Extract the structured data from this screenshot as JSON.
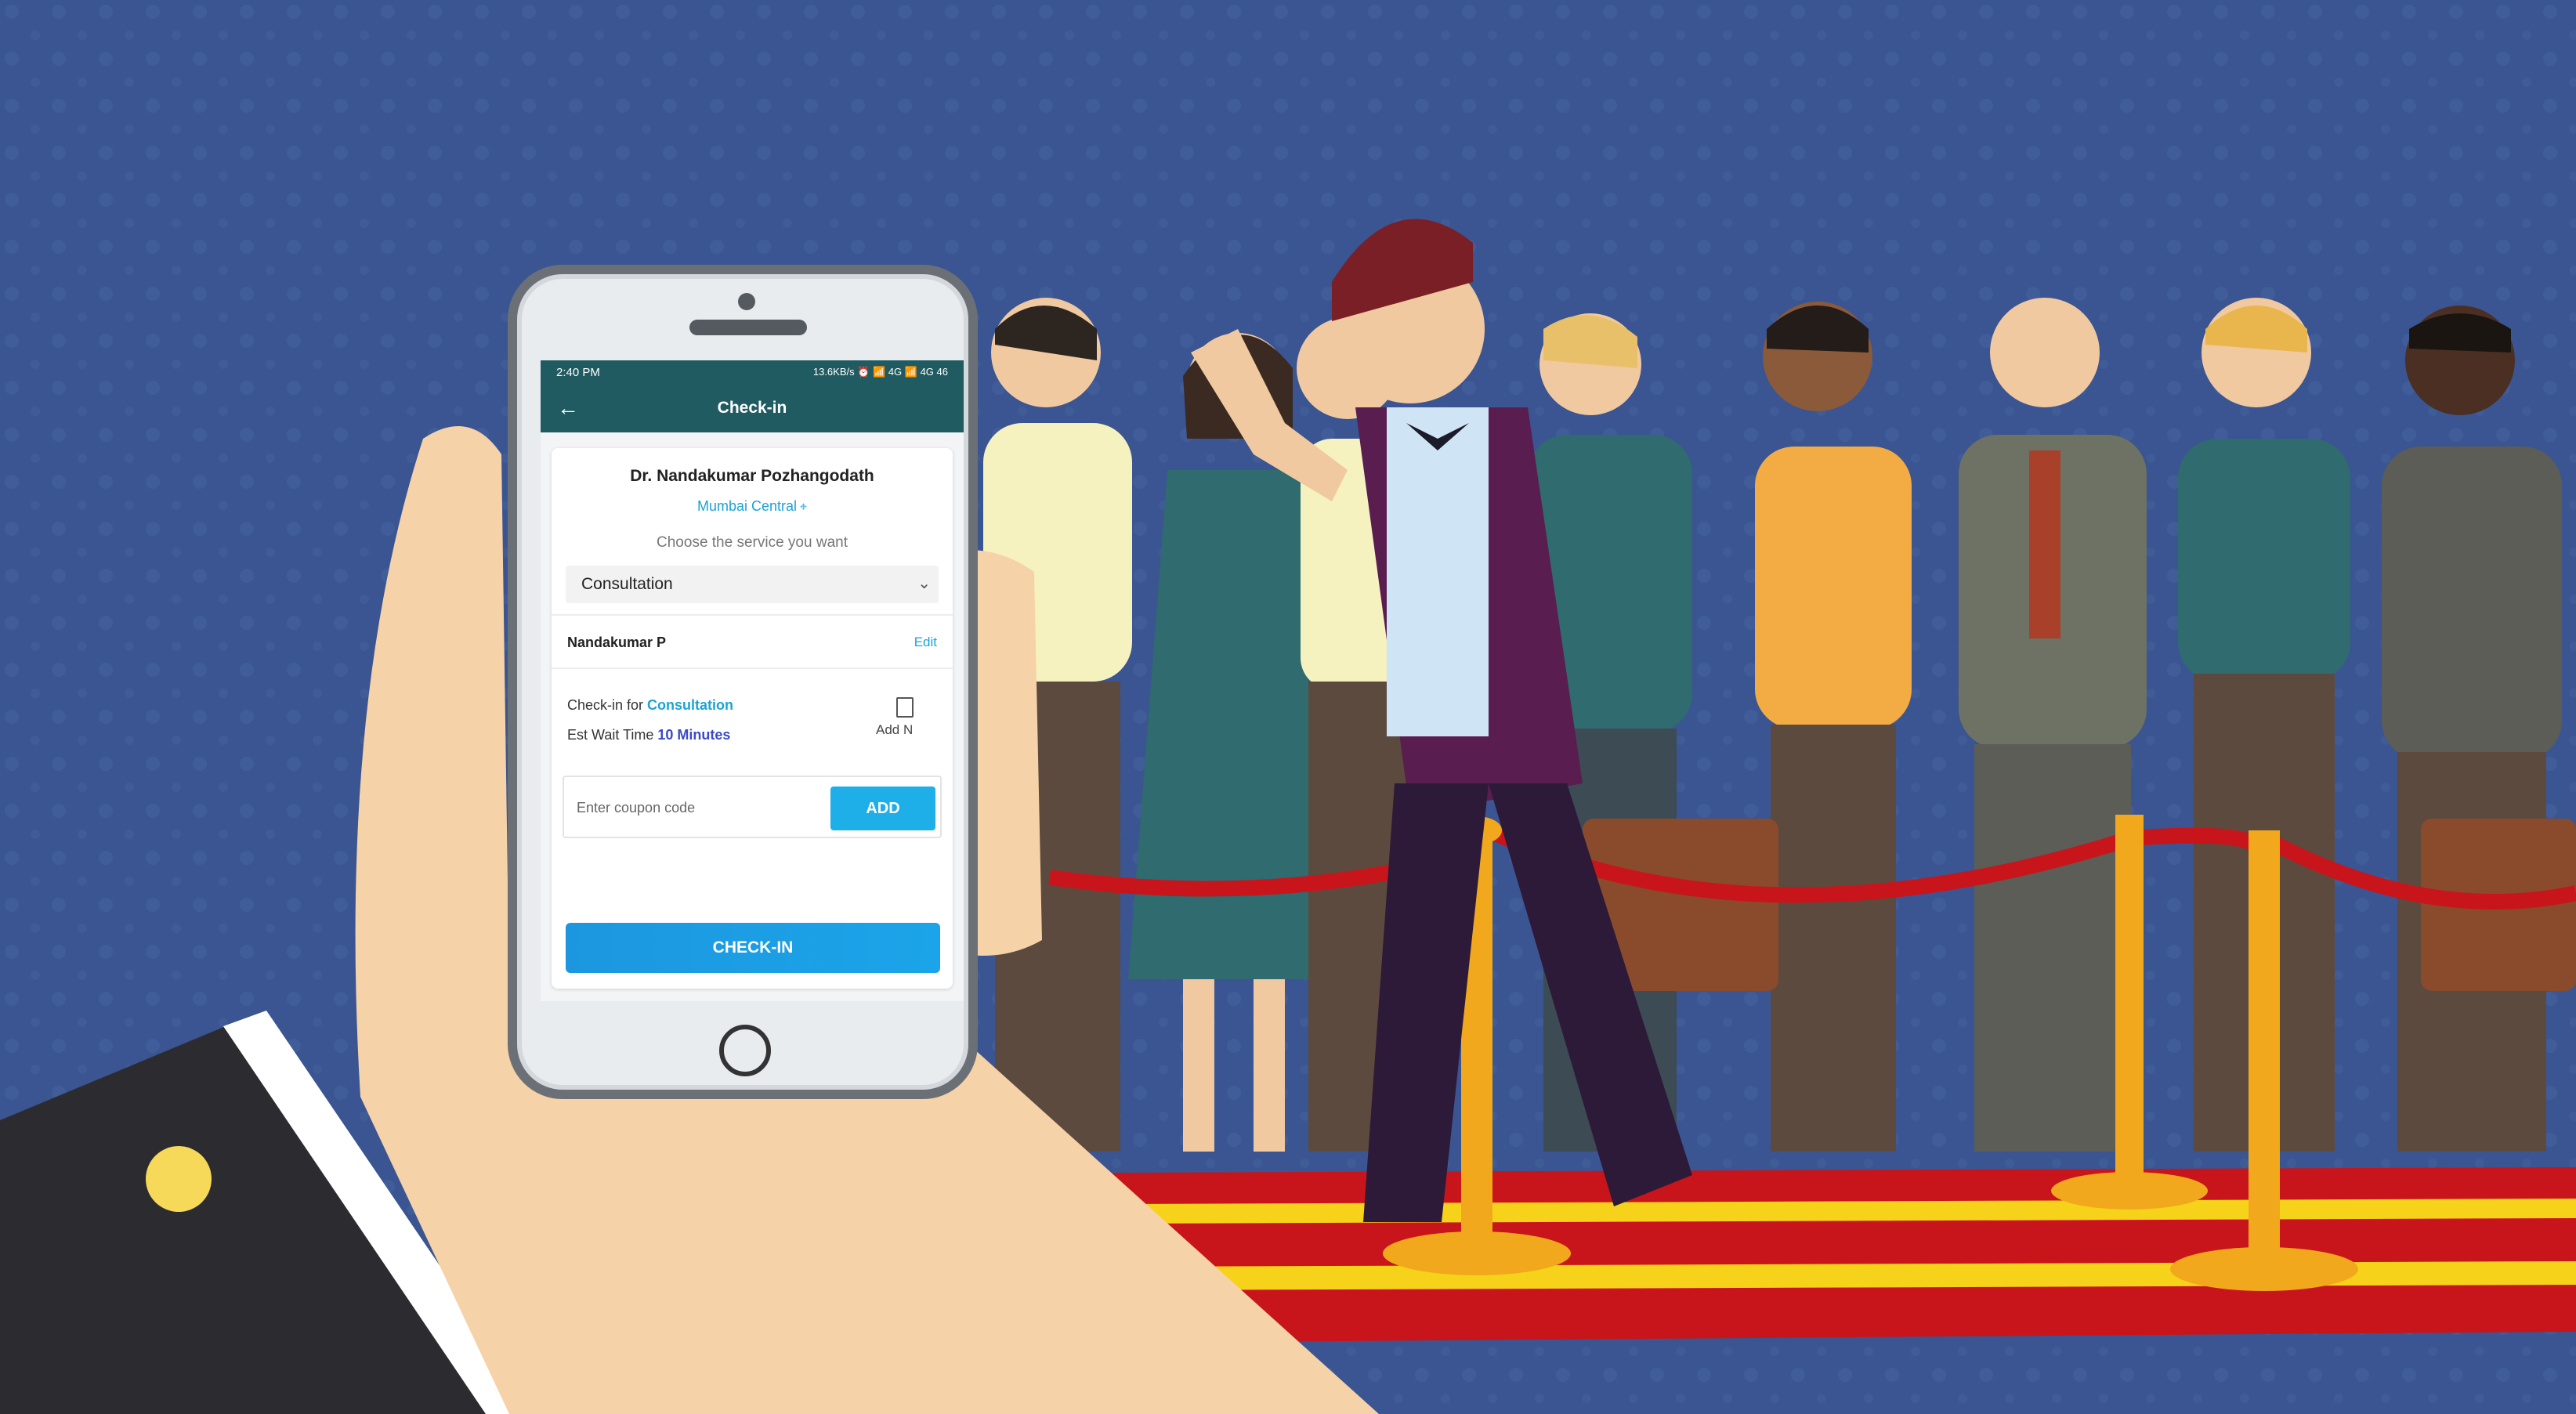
{
  "status_bar": {
    "time": "2:40 PM",
    "indicators": "13.6KB/s ⏰ 📶 4G 📶 4G 46"
  },
  "app_bar": {
    "back_icon": "arrow-left-icon",
    "title": "Check-in"
  },
  "doctor": {
    "name": "Dr. Nandakumar Pozhangodath",
    "location": "Mumbai Central",
    "location_icon": "map-pin-icon"
  },
  "service": {
    "prompt": "Choose the service you want",
    "selected": "Consultation"
  },
  "patient": {
    "name": "Nandakumar P",
    "edit_label": "Edit"
  },
  "checkin_info": {
    "for_label": "Check-in for",
    "service": "Consultation",
    "wait_label": "Est Wait Time",
    "wait_value": "10 Minutes",
    "add_note_label": "Add N"
  },
  "coupon": {
    "placeholder": "Enter coupon code",
    "add_label": "ADD"
  },
  "checkin_button": "CHECK-IN",
  "colors": {
    "background": "#3a5591",
    "app_bar": "#1f5b61",
    "accent": "#1ba3d6",
    "red_carpet": "#c8151b",
    "stanchion_gold": "#f2a81c"
  }
}
